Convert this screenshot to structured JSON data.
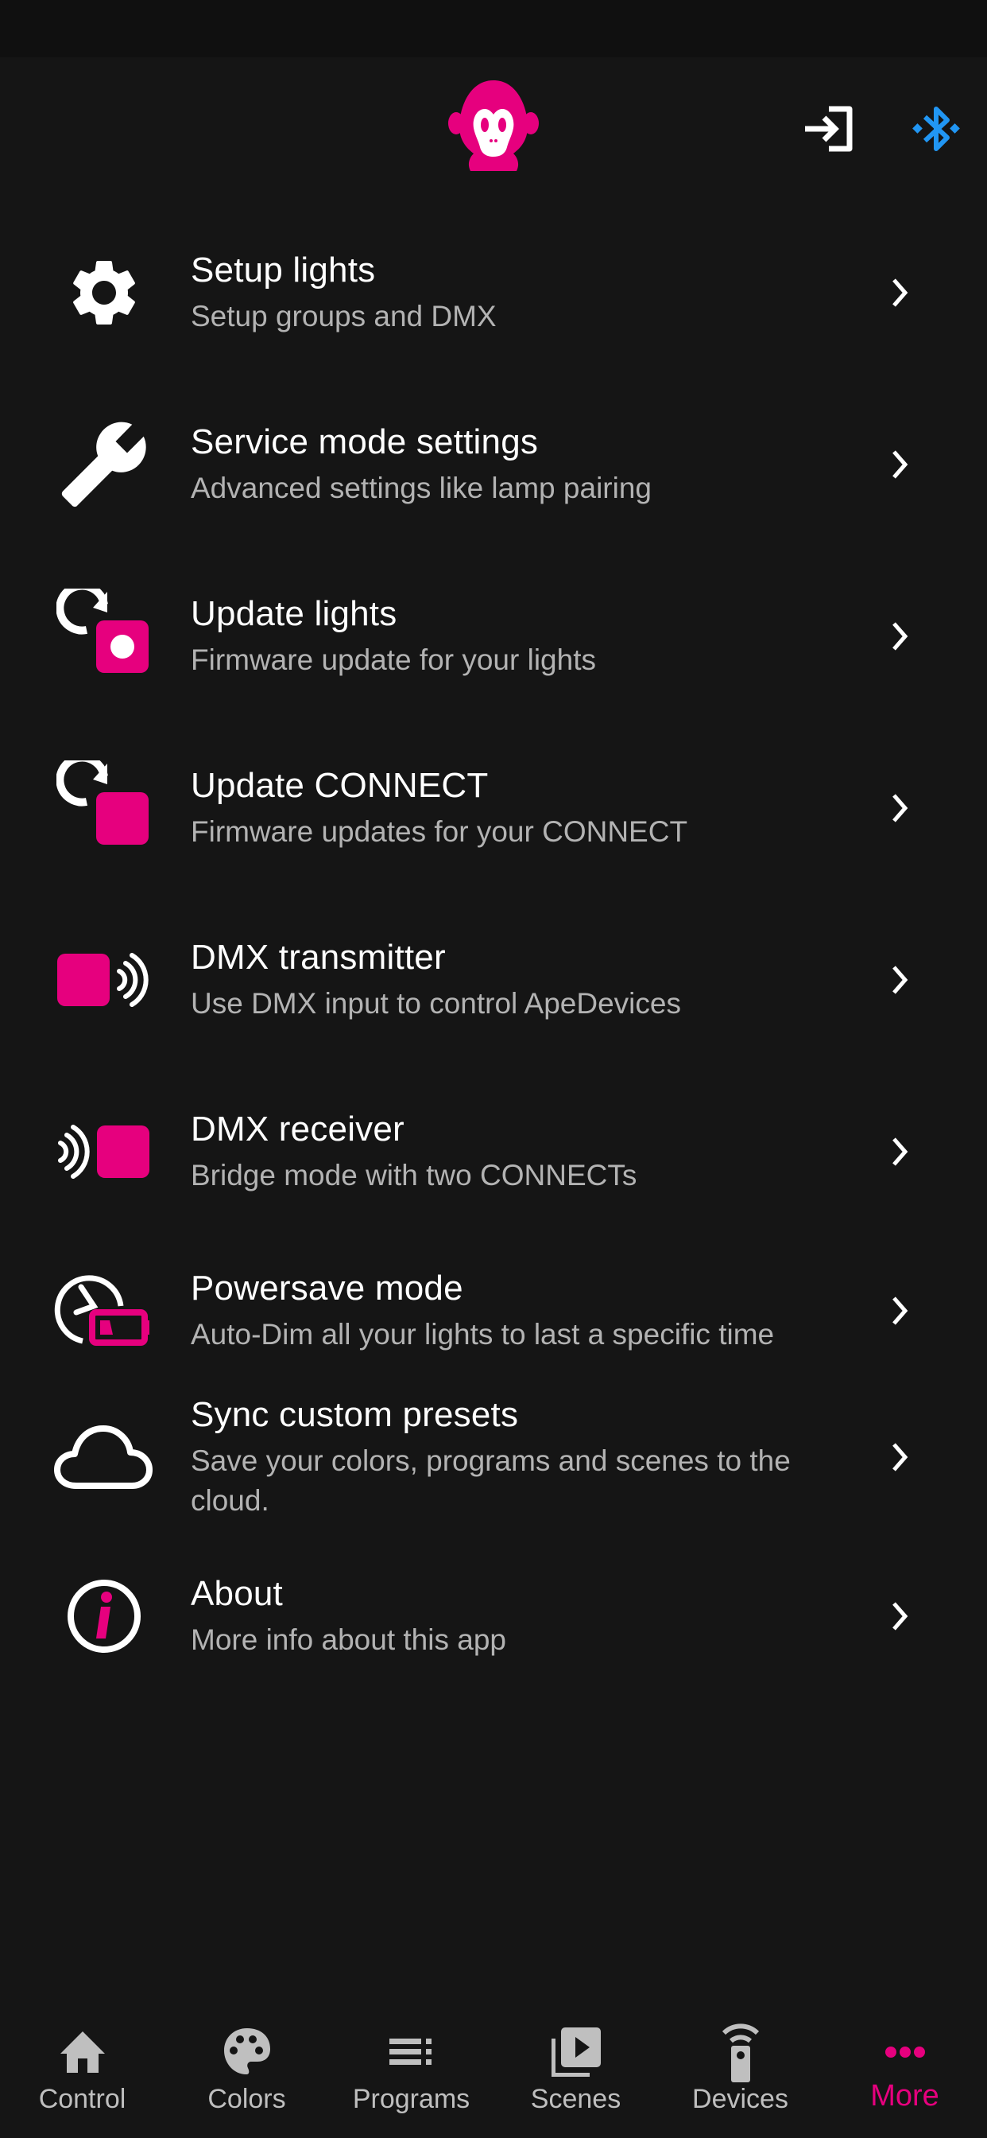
{
  "colors": {
    "accent": "#e6007e",
    "bluetooth": "#2196f3",
    "background": "#151515",
    "subtitle": "#b3b3b3",
    "tab_inactive": "#bfbfbf"
  },
  "header": {
    "logo": "monkey-logo",
    "login_icon": "login-icon",
    "bluetooth_icon": "bluetooth-icon"
  },
  "menu": [
    {
      "icon": "gear-icon",
      "title": "Setup lights",
      "subtitle": "Setup groups and DMX"
    },
    {
      "icon": "wrench-icon",
      "title": "Service mode settings",
      "subtitle": "Advanced settings like lamp pairing"
    },
    {
      "icon": "update-lights-icon",
      "title": "Update lights",
      "subtitle": "Firmware update for your lights"
    },
    {
      "icon": "update-connect-icon",
      "title": "Update CONNECT",
      "subtitle": "Firmware updates for your CONNECT"
    },
    {
      "icon": "dmx-transmitter-icon",
      "title": "DMX transmitter",
      "subtitle": "Use DMX input to control ApeDevices"
    },
    {
      "icon": "dmx-receiver-icon",
      "title": "DMX receiver",
      "subtitle": "Bridge mode with two CONNECTs"
    },
    {
      "icon": "powersave-icon",
      "title": "Powersave mode",
      "subtitle": "Auto-Dim all your lights to last a specific time"
    },
    {
      "icon": "cloud-icon",
      "title": "Sync custom presets",
      "subtitle": "Save your colors, programs and scenes to the cloud."
    },
    {
      "icon": "info-icon",
      "title": "About",
      "subtitle": "More info about this app"
    }
  ],
  "tabs": [
    {
      "icon": "home-icon",
      "label": "Control",
      "active": false
    },
    {
      "icon": "palette-icon",
      "label": "Colors",
      "active": false
    },
    {
      "icon": "list-icon",
      "label": "Programs",
      "active": false
    },
    {
      "icon": "scenes-icon",
      "label": "Scenes",
      "active": false
    },
    {
      "icon": "remote-icon",
      "label": "Devices",
      "active": false
    },
    {
      "icon": "more-icon",
      "label": "More",
      "active": true
    }
  ]
}
